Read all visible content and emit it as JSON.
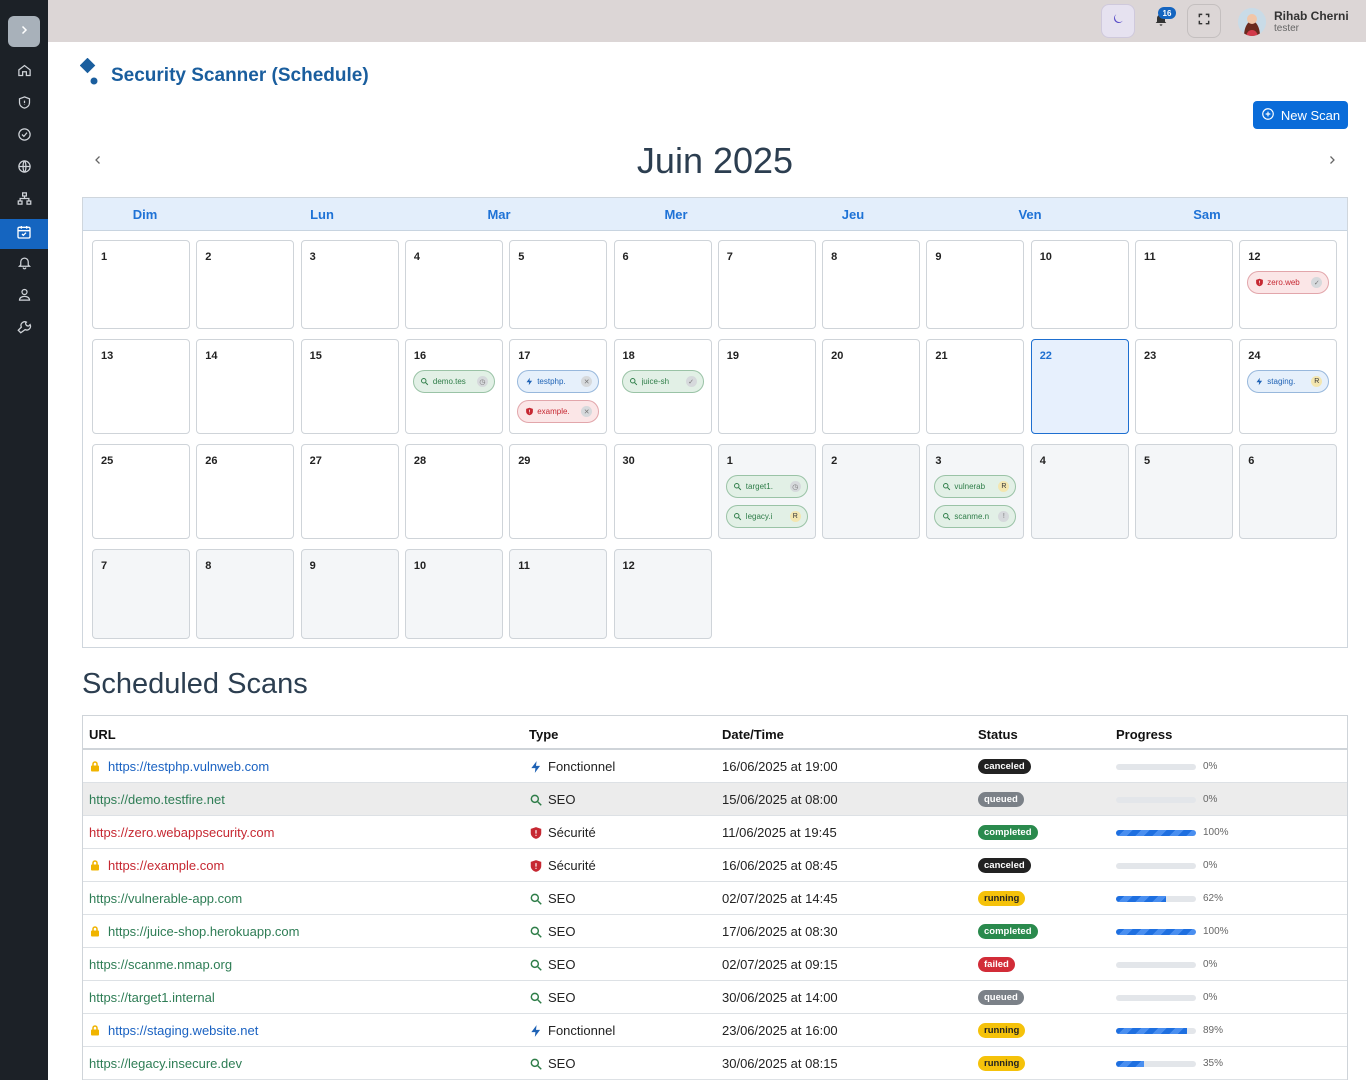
{
  "header": {
    "notification_count": "16",
    "user_name": "Rihab Cherni",
    "user_role": "tester"
  },
  "sidebar": {
    "items": [
      {
        "icon": "home-icon"
      },
      {
        "icon": "shield-icon"
      },
      {
        "icon": "check-circle-icon"
      },
      {
        "icon": "globe-icon"
      },
      {
        "icon": "sitemap-icon"
      },
      {
        "icon": "calendar-check-icon",
        "active": true
      },
      {
        "icon": "bell-icon"
      },
      {
        "icon": "user-icon"
      },
      {
        "icon": "wrench-icon"
      }
    ]
  },
  "page": {
    "title": "Security Scanner (Schedule)",
    "new_scan_label": "New Scan"
  },
  "calendar": {
    "month_label": "Juin 2025",
    "day_names": [
      "Dim",
      "Lun",
      "Mar",
      "Mer",
      "Jeu",
      "Ven",
      "Sam"
    ],
    "weeks": [
      [
        {
          "n": "1"
        },
        {
          "n": "2"
        },
        {
          "n": "3"
        },
        {
          "n": "4"
        },
        {
          "n": "5"
        },
        {
          "n": "6"
        },
        {
          "n": "7"
        },
        {
          "n": "8"
        },
        {
          "n": "9"
        },
        {
          "n": "10"
        },
        {
          "n": "11"
        },
        {
          "n": "12",
          "events": [
            {
              "label": "zero.web",
              "type": "sec",
              "mark": "✓"
            }
          ]
        }
      ],
      [
        {
          "n": "13"
        },
        {
          "n": "14"
        },
        {
          "n": "15"
        },
        {
          "n": "16",
          "events": [
            {
              "label": "demo.tes",
              "type": "seo",
              "mark": "◷"
            }
          ]
        },
        {
          "n": "17",
          "events": [
            {
              "label": "testphp.",
              "type": "func",
              "mark": "✕"
            },
            {
              "label": "example.",
              "type": "sec",
              "mark": "✕"
            }
          ]
        },
        {
          "n": "18",
          "events": [
            {
              "label": "juice-sh",
              "type": "seo",
              "mark": "✓"
            }
          ]
        },
        {
          "n": "19"
        },
        {
          "n": "20"
        },
        {
          "n": "21"
        },
        {
          "n": "22",
          "today": true
        },
        {
          "n": "23"
        },
        {
          "n": "24",
          "events": [
            {
              "label": "staging.",
              "type": "func",
              "mark": "R"
            }
          ]
        }
      ],
      [
        {
          "n": "25"
        },
        {
          "n": "26"
        },
        {
          "n": "27"
        },
        {
          "n": "28"
        },
        {
          "n": "29"
        },
        {
          "n": "30"
        },
        {
          "n": "1",
          "other": true,
          "events": [
            {
              "label": "target1.",
              "type": "seo",
              "mark": "◷"
            },
            {
              "label": "legacy.i",
              "type": "seo",
              "mark": "R"
            }
          ]
        },
        {
          "n": "2",
          "other": true
        },
        {
          "n": "3",
          "other": true,
          "events": [
            {
              "label": "vulnerab",
              "type": "seo",
              "mark": "R"
            },
            {
              "label": "scanme.n",
              "type": "seo",
              "mark": "!"
            }
          ]
        },
        {
          "n": "4",
          "other": true
        },
        {
          "n": "5",
          "other": true
        },
        {
          "n": "6",
          "other": true
        }
      ],
      [
        {
          "n": "7",
          "other": true
        },
        {
          "n": "8",
          "other": true
        },
        {
          "n": "9",
          "other": true
        },
        {
          "n": "10",
          "other": true
        },
        {
          "n": "11",
          "other": true
        },
        {
          "n": "12",
          "other": true
        }
      ]
    ]
  },
  "scheduled": {
    "title": "Scheduled Scans",
    "columns": [
      "URL",
      "Type",
      "Date/Time",
      "Status",
      "Progress"
    ],
    "rows": [
      {
        "lock": true,
        "url": "https://testphp.vulnweb.com",
        "color": "blue",
        "type": "Fonctionnel",
        "type_icon": "func",
        "date": "16/06/2025 at 19:00",
        "status": "canceled",
        "progress": 0
      },
      {
        "lock": false,
        "url": "https://demo.testfire.net",
        "color": "green",
        "type": "SEO",
        "type_icon": "seo",
        "date": "15/06/2025 at 08:00",
        "status": "queued",
        "progress": 0,
        "highlight": true
      },
      {
        "lock": false,
        "url": "https://zero.webappsecurity.com",
        "color": "red",
        "type": "Sécurité",
        "type_icon": "sec",
        "date": "11/06/2025 at 19:45",
        "status": "completed",
        "progress": 100
      },
      {
        "lock": true,
        "url": "https://example.com",
        "color": "red",
        "type": "Sécurité",
        "type_icon": "sec",
        "date": "16/06/2025 at 08:45",
        "status": "canceled",
        "progress": 0
      },
      {
        "lock": false,
        "url": "https://vulnerable-app.com",
        "color": "green",
        "type": "SEO",
        "type_icon": "seo",
        "date": "02/07/2025 at 14:45",
        "status": "running",
        "progress": 62
      },
      {
        "lock": true,
        "url": "https://juice-shop.herokuapp.com",
        "color": "green",
        "type": "SEO",
        "type_icon": "seo",
        "date": "17/06/2025 at 08:30",
        "status": "completed",
        "progress": 100
      },
      {
        "lock": false,
        "url": "https://scanme.nmap.org",
        "color": "green",
        "type": "SEO",
        "type_icon": "seo",
        "date": "02/07/2025 at 09:15",
        "status": "failed",
        "progress": 0
      },
      {
        "lock": false,
        "url": "https://target1.internal",
        "color": "green",
        "type": "SEO",
        "type_icon": "seo",
        "date": "30/06/2025 at 14:00",
        "status": "queued",
        "progress": 0
      },
      {
        "lock": true,
        "url": "https://staging.website.net",
        "color": "blue",
        "type": "Fonctionnel",
        "type_icon": "func",
        "date": "23/06/2025 at 16:00",
        "status": "running",
        "progress": 89
      },
      {
        "lock": false,
        "url": "https://legacy.insecure.dev",
        "color": "green",
        "type": "SEO",
        "type_icon": "seo",
        "date": "30/06/2025 at 08:15",
        "status": "running",
        "progress": 35
      }
    ]
  }
}
